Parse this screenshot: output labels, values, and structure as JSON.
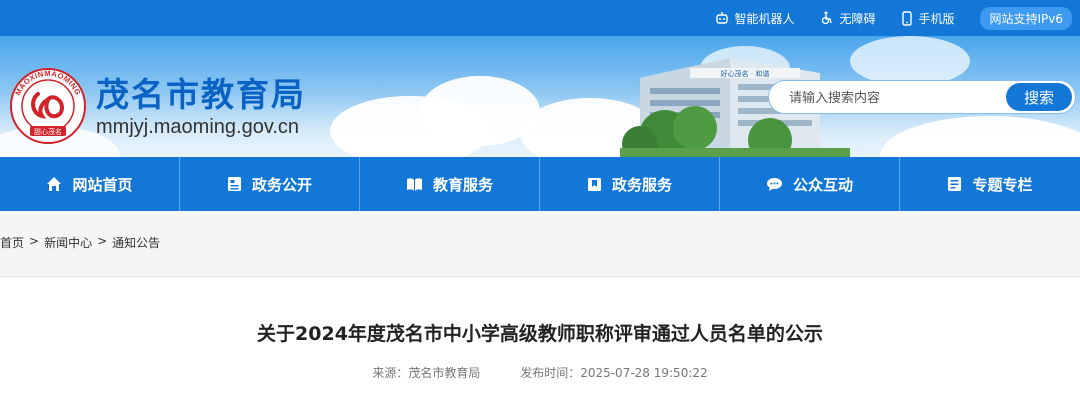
{
  "topbar": {
    "robot": "智能机器人",
    "accessibility": "无障碍",
    "mobile": "手机版",
    "ipv6": "网站支持IPv6"
  },
  "header": {
    "logo_ring_text": "MAOXINMAOMING",
    "logo_bottom_text": "甜心茂名",
    "site_name": "茂名市教育局",
    "domain": "mmjyj.maoming.gov.cn",
    "building_slogan": "好心茂名 · 和谐"
  },
  "search": {
    "placeholder": "请输入搜索内容",
    "button": "搜索"
  },
  "nav": [
    {
      "label": "网站首页",
      "icon": "home-icon"
    },
    {
      "label": "政务公开",
      "icon": "document-icon"
    },
    {
      "label": "教育服务",
      "icon": "book-icon"
    },
    {
      "label": "政务服务",
      "icon": "bookmark-icon"
    },
    {
      "label": "公众互动",
      "icon": "chat-icon"
    },
    {
      "label": "专题专栏",
      "icon": "list-icon"
    }
  ],
  "breadcrumb": [
    "首页",
    "新闻中心",
    "通知公告"
  ],
  "breadcrumb_sep": ">",
  "article": {
    "title": "关于2024年度茂名市中小学高级教师职称评审通过人员名单的公示",
    "source": "来源：茂名市教育局",
    "published": "发布时间：2025-07-28 19:50:22"
  },
  "colors": {
    "primary": "#1377d8",
    "brand_text": "#0a63c4",
    "logo_red": "#d2232a"
  }
}
